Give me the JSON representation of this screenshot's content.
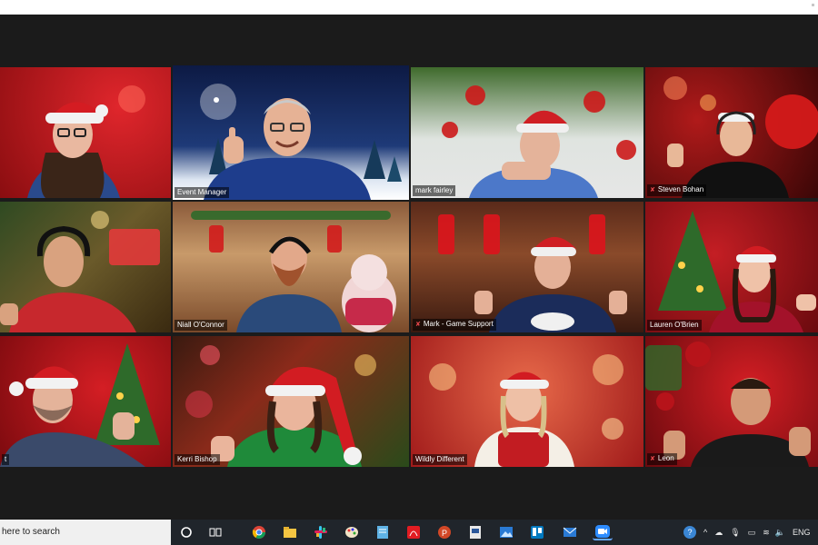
{
  "participants": [
    {
      "name": "",
      "muted": false
    },
    {
      "name": "Event Manager",
      "muted": false
    },
    {
      "name": "mark fairley",
      "muted": false
    },
    {
      "name": "Steven Bohan",
      "muted": true
    },
    {
      "name": "",
      "muted": false
    },
    {
      "name": "Niall O'Connor",
      "muted": false
    },
    {
      "name": "Mark - Game Support",
      "muted": true
    },
    {
      "name": "Lauren O'Brien",
      "muted": false
    },
    {
      "name": "t",
      "muted": false
    },
    {
      "name": "Kerri Bishop",
      "muted": false
    },
    {
      "name": "Wildly Different",
      "muted": false
    },
    {
      "name": "Leon",
      "muted": true
    }
  ],
  "active_speaker": "Event Manager",
  "taskbar": {
    "search_placeholder": "here to search",
    "language": "ENG",
    "apps": [
      "task-view",
      "chrome",
      "file-explorer",
      "slack",
      "paint",
      "notepad",
      "acrobat",
      "powerpoint",
      "word-doc",
      "photos",
      "trello",
      "mail",
      "zoom"
    ],
    "active_app": "zoom"
  },
  "colors": {
    "active_border": "#d9e04a",
    "mute_icon": "#e8474b",
    "taskbar": "#20252b"
  }
}
